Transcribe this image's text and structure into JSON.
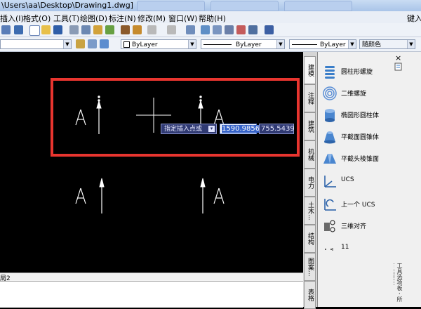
{
  "window": {
    "title": "\\Users\\aa\\Desktop\\Drawing1.dwg]",
    "right_label": "键入"
  },
  "menu": [
    "插入(I)",
    "格式(O)",
    "工具(T)",
    "绘图(D)",
    "标注(N)",
    "修改(M)",
    "窗口(W)",
    "帮助(H)"
  ],
  "properties": {
    "color": "ByLayer",
    "linetype": "ByLayer",
    "lineweight": "ByLayer",
    "plotstyle": "随颜色"
  },
  "canvas": {
    "prompt": "指定插入点或",
    "x_value": "1590.9856",
    "y_value": "755.5439",
    "text_a": "A",
    "layout_tab": "局2"
  },
  "palette": {
    "tabs": [
      "建模",
      "注释",
      "建筑",
      "机械",
      "电力",
      "土木...",
      "结构",
      "图案...",
      "表格"
    ],
    "items": [
      {
        "label": "圆柱形螺旋",
        "icon": "helix-cylinder-icon"
      },
      {
        "label": "二维螺旋",
        "icon": "spiral-2d-icon"
      },
      {
        "label": "椭圆形圆柱体",
        "icon": "elliptical-cylinder-icon"
      },
      {
        "label": "平截面圆锥体",
        "icon": "frustum-cone-icon"
      },
      {
        "label": "平截头棱锥面",
        "icon": "frustum-pyramid-icon"
      },
      {
        "label": "UCS",
        "icon": "ucs-icon"
      },
      {
        "label": "上一个 UCS",
        "icon": "previous-ucs-icon"
      },
      {
        "label": "三维对齐",
        "icon": "align-3d-icon"
      },
      {
        "label": "11",
        "icon": "block-11-icon"
      }
    ],
    "side_title": "工具选项板 - 所有选项板",
    "close": "×"
  },
  "colors": {
    "highlight": "#e8352f",
    "canvas_bg": "#000000"
  }
}
